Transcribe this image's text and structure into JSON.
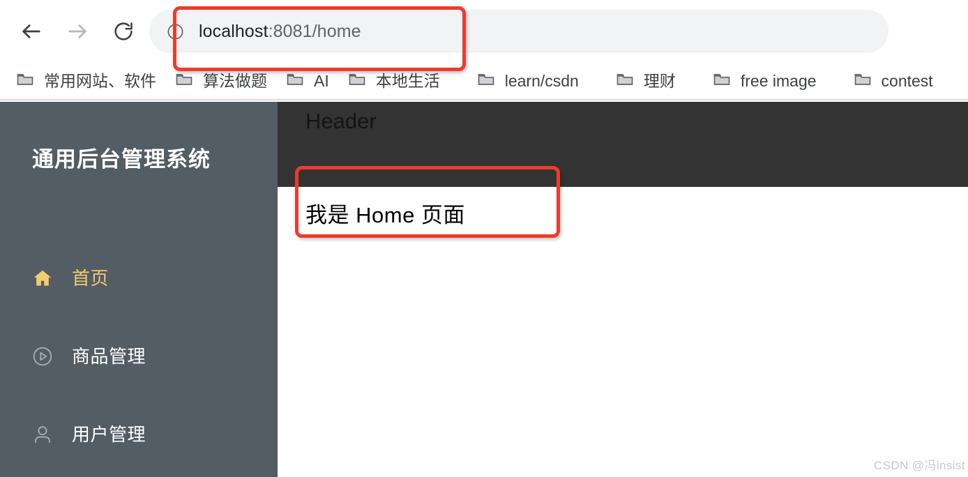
{
  "browser": {
    "back_label": "Back",
    "forward_label": "Forward",
    "reload_label": "Reload",
    "site_info_icon": "info-circle-icon",
    "url": {
      "host": "localhost",
      "rest": ":8081/home",
      "full": "localhost:8081/home"
    },
    "bookmarks": [
      {
        "label": "常用网站、软件",
        "icon": "folder-icon"
      },
      {
        "label": "算法做题",
        "icon": "folder-icon"
      },
      {
        "label": "AI",
        "icon": "folder-icon"
      },
      {
        "label": "本地生活",
        "icon": "folder-icon"
      },
      {
        "label": "learn/csdn",
        "icon": "folder-icon"
      },
      {
        "label": "理财",
        "icon": "folder-icon"
      },
      {
        "label": "free image",
        "icon": "folder-icon"
      },
      {
        "label": "contest",
        "icon": "folder-icon"
      }
    ]
  },
  "app": {
    "sidebar": {
      "title": "通用后台管理系统",
      "background_color": "#545c64",
      "active_color": "#f3cb70",
      "items": [
        {
          "label": "首页",
          "icon": "home-icon",
          "active": true
        },
        {
          "label": "商品管理",
          "icon": "play-circle-icon",
          "active": false
        },
        {
          "label": "用户管理",
          "icon": "user-icon",
          "active": false
        }
      ]
    },
    "header": {
      "title": "Header",
      "background_color": "#333333"
    },
    "content": {
      "text": "我是 Home 页面"
    }
  },
  "annotations": {
    "color": "#ee3b2b",
    "url_box_target": "localhost:8081/home",
    "content_box_target": "我是 Home 页面"
  },
  "watermark": {
    "text": "CSDN @冯insist"
  }
}
